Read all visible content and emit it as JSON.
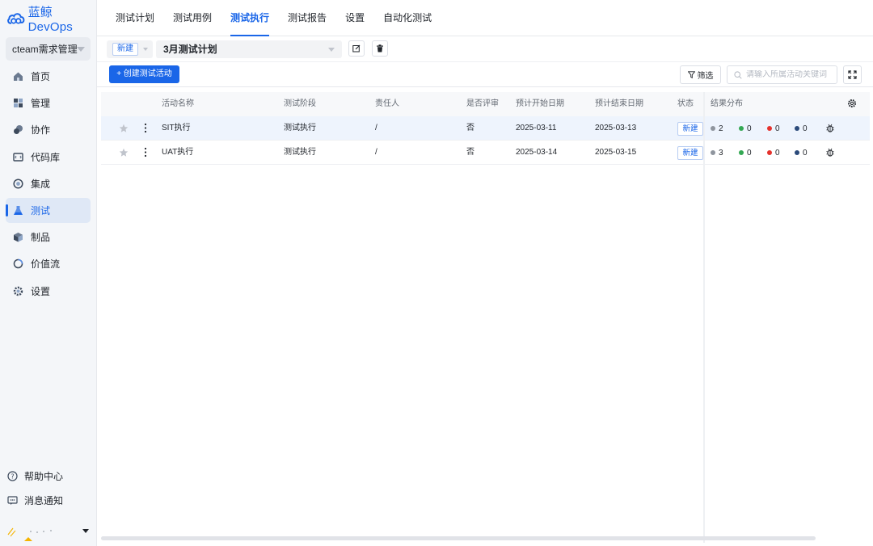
{
  "brand": {
    "name": "蓝鲸DevOps",
    "accent": "#1a66e8"
  },
  "project": {
    "name": "cteam需求管理"
  },
  "nav": [
    {
      "label": "首页",
      "icon": "home-icon"
    },
    {
      "label": "管理",
      "icon": "manage-icon"
    },
    {
      "label": "协作",
      "icon": "collaboration-icon"
    },
    {
      "label": "代码库",
      "icon": "code-repo-icon"
    },
    {
      "label": "集成",
      "icon": "integration-icon"
    },
    {
      "label": "测试",
      "icon": "test-flask-icon",
      "active": true
    },
    {
      "label": "制品",
      "icon": "artifact-icon"
    },
    {
      "label": "价值流",
      "icon": "value-stream-icon"
    },
    {
      "label": "设置",
      "icon": "settings-icon"
    }
  ],
  "sidebar_bottom": {
    "help": "帮助中心",
    "notifications": "消息通知"
  },
  "tabs": [
    {
      "label": "测试计划"
    },
    {
      "label": "测试用例"
    },
    {
      "label": "测试执行",
      "active": true
    },
    {
      "label": "测试报告"
    },
    {
      "label": "设置"
    },
    {
      "label": "自动化测试"
    }
  ],
  "plan": {
    "status": "新建",
    "name": "3月测试计划"
  },
  "toolbar": {
    "create_label": "+ 创建测试活动",
    "filter_label": "筛选",
    "search_placeholder": "请输入所属活动关键词"
  },
  "table": {
    "columns": {
      "name": "活动名称",
      "stage": "测试阶段",
      "owner": "责任人",
      "review": "是否评审",
      "start": "预计开始日期",
      "end": "预计结束日期",
      "status": "状态",
      "results": "结果分布"
    },
    "rows": [
      {
        "name": "SIT执行",
        "stage": "测试执行",
        "owner": "/",
        "review": "否",
        "start": "2025-03-11",
        "end": "2025-03-13",
        "status": "新建",
        "results": {
          "gray": "2",
          "green": "0",
          "red": "0",
          "navy": "0"
        }
      },
      {
        "name": "UAT执行",
        "stage": "测试执行",
        "owner": "/",
        "review": "否",
        "start": "2025-03-14",
        "end": "2025-03-15",
        "status": "新建",
        "results": {
          "gray": "3",
          "green": "0",
          "red": "0",
          "navy": "0"
        }
      }
    ]
  },
  "colors": {
    "gray": "#8f959e",
    "green": "#34a853",
    "red": "#e5322d",
    "navy": "#2b4a7a"
  }
}
